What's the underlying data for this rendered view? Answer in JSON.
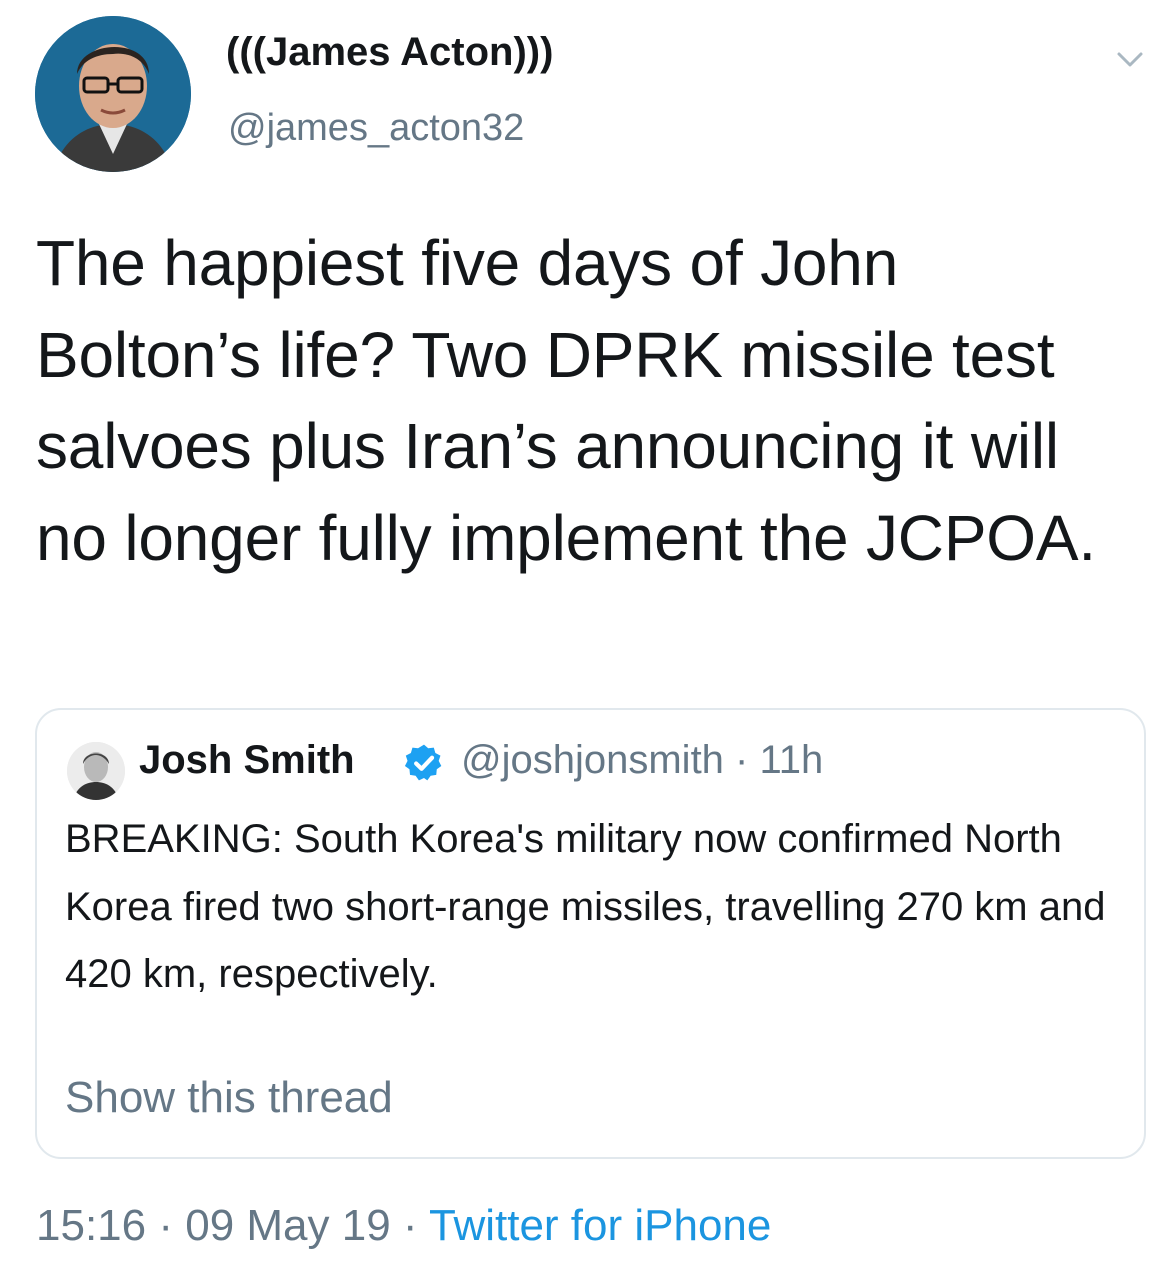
{
  "tweet": {
    "author": {
      "display_name": "(((James Acton)))",
      "handle": "@james_acton32",
      "avatar_icon": "profile-photo"
    },
    "menu_icon": "chevron-down-icon",
    "text": "The happiest five days of John Bolton’s life? Two DPRK missile test salvoes plus Iran’s announcing it will no longer fully implement the JCPOA.",
    "quoted": {
      "display_name": "Josh Smith",
      "handle": "@joshjonsmith",
      "separator": " · ",
      "age": "11h",
      "verified_icon": "verified-badge-icon",
      "text": "BREAKING: South Korea's military now confirmed North Korea fired two short-range missiles, travelling 270 km and 420 km, respectively.",
      "show_thread": "Show this thread"
    },
    "time": "15:16",
    "date": "09 May 19",
    "dot": " · ",
    "source": "Twitter for iPhone"
  },
  "colors": {
    "text": "#14171a",
    "secondary": "#657786",
    "link": "#1b95e0",
    "border": "#e1e8ed",
    "verified": "#1da1f2"
  }
}
